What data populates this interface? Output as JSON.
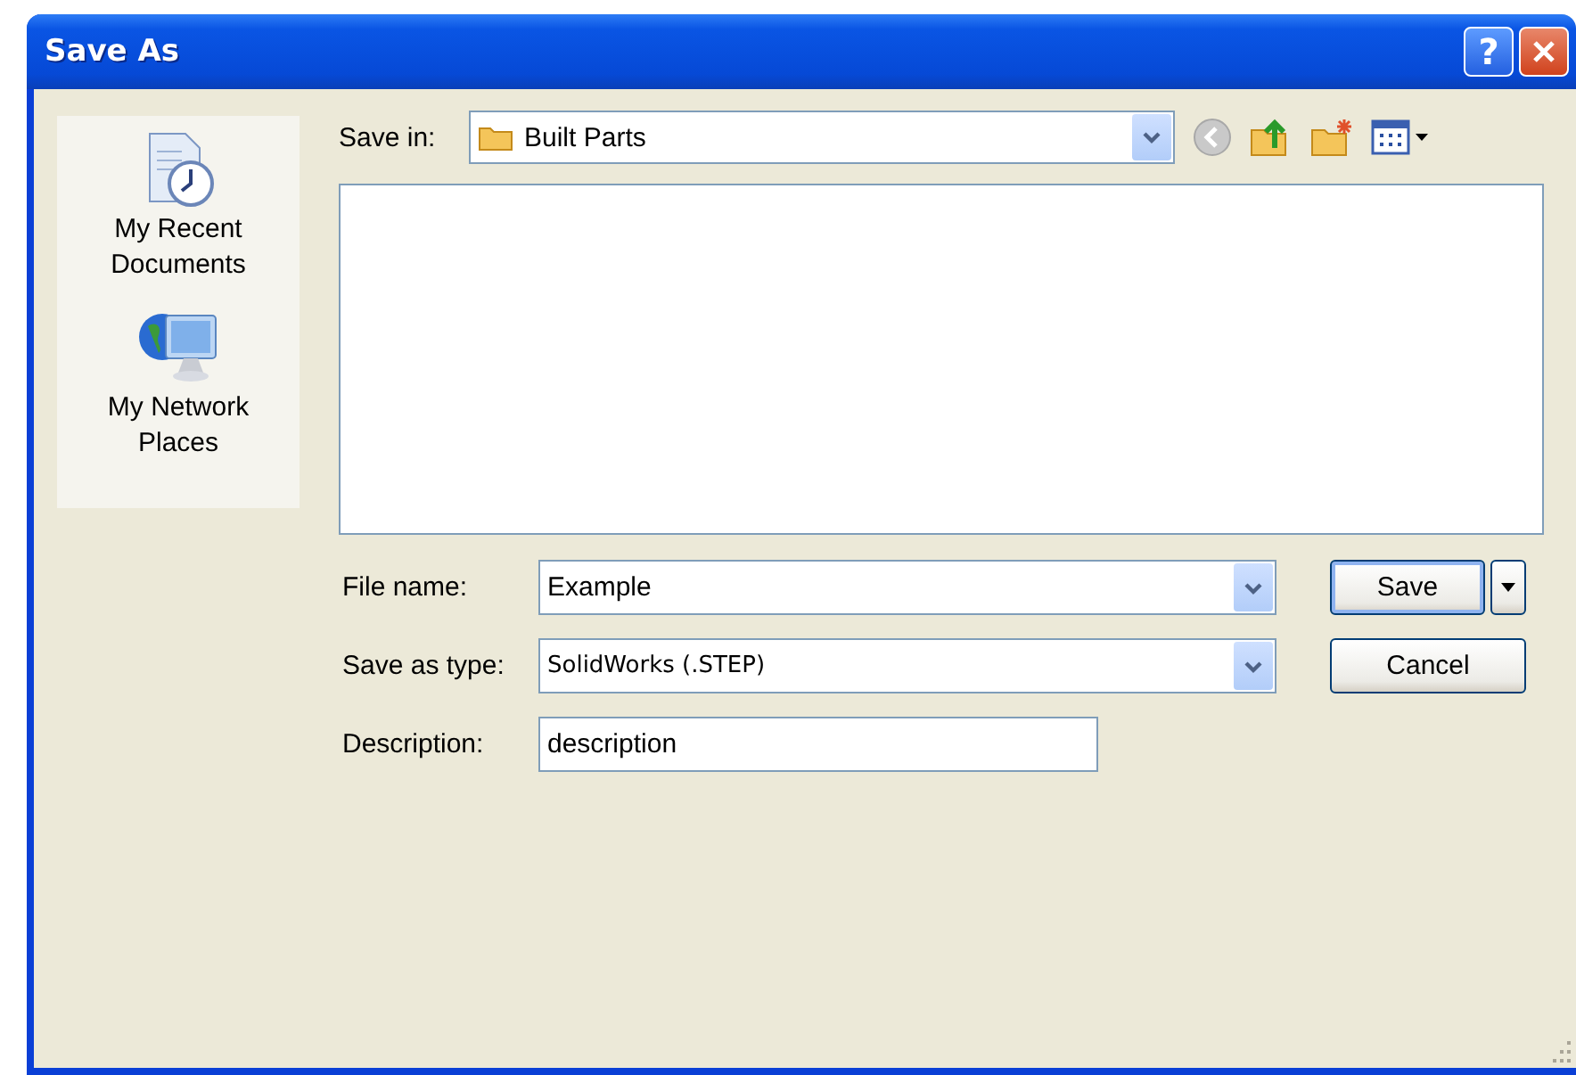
{
  "window": {
    "title": "Save As",
    "help": "?"
  },
  "places": [
    {
      "label": "My Recent Documents",
      "kind": "recent"
    },
    {
      "label": "My Network Places",
      "kind": "network"
    }
  ],
  "save_in": {
    "label": "Save in:",
    "value": "Built Parts"
  },
  "fields": [
    {
      "label": "File name:",
      "value": "Example",
      "kind": "combo"
    },
    {
      "label": "Save as type:",
      "value": "SolidWorks (.STEP)",
      "kind": "combo"
    },
    {
      "label": "Description:",
      "value": "description",
      "kind": "text"
    }
  ],
  "buttons": [
    {
      "label": "Save",
      "kind": "split",
      "default": true
    },
    {
      "label": "Cancel",
      "kind": "plain",
      "default": false
    }
  ]
}
